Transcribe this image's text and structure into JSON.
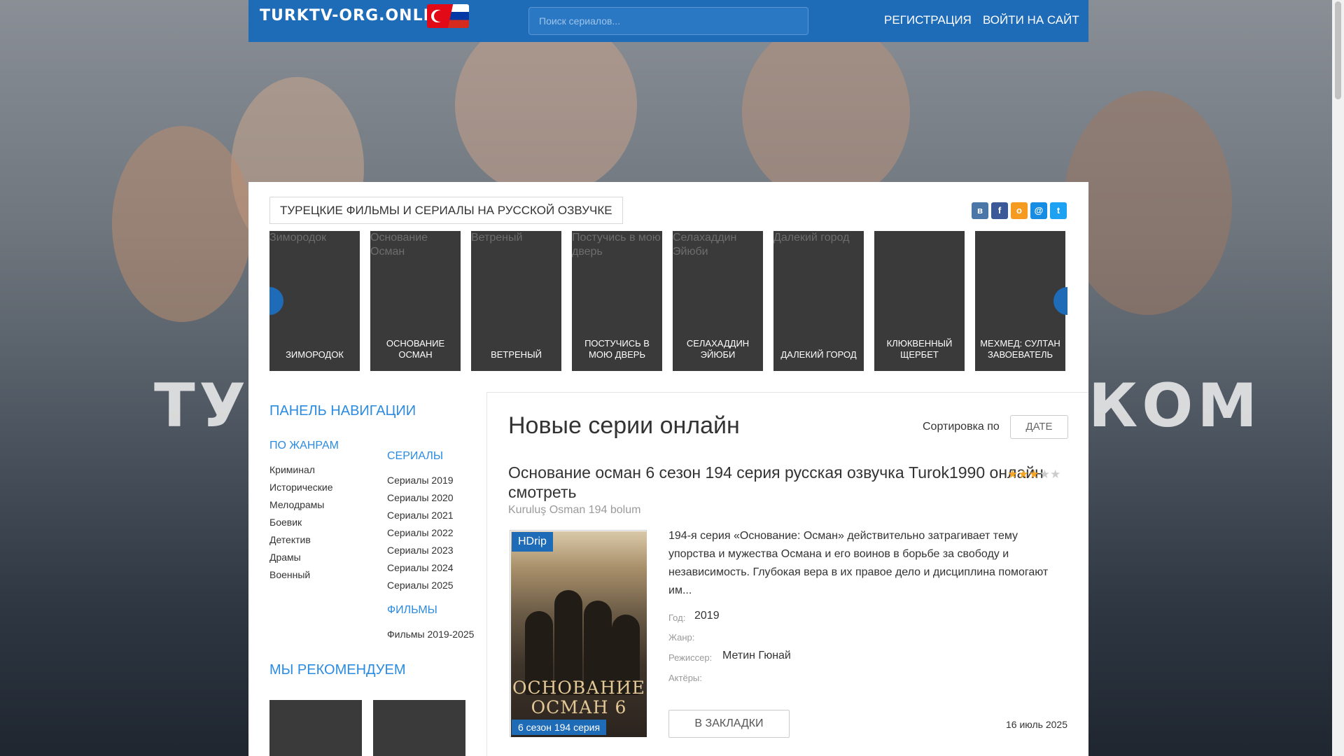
{
  "colors": {
    "brand": "#1e6bb8",
    "accent": "#2a8be0",
    "star": "#f5a623"
  },
  "header": {
    "logo_text": "TURKTV-ORG.ONLINE",
    "search_placeholder": "Поиск сериалов...",
    "register": "РЕГИСТРАЦИЯ",
    "login": "ВОЙТИ НА САЙТ"
  },
  "page_title": "ТУРЕЦКИЕ ФИЛЬМЫ И СЕРИАЛЫ НА РУССКОЙ ОЗВУЧКЕ",
  "share_icons": [
    "vk-icon",
    "facebook-icon",
    "odnoklassniki-icon",
    "moimir-icon",
    "twitter-icon"
  ],
  "slider": [
    {
      "alt": "Зимородок",
      "caption": "ЗИМОРОДОК"
    },
    {
      "alt": "Основание Осман",
      "caption": "ОСНОВАНИЕ ОСМАН"
    },
    {
      "alt": "Ветреный",
      "caption": "ВЕТРЕНЫЙ"
    },
    {
      "alt": "Постучись в мою дверь",
      "caption": "ПОСТУЧИСЬ В МОЮ ДВЕРЬ"
    },
    {
      "alt": "Селахаддин Эйюби",
      "caption": "СЕЛАХАДДИН ЭЙЮБИ"
    },
    {
      "alt": "Далекий город",
      "caption": "ДАЛЕКИЙ ГОРОД"
    },
    {
      "alt": "",
      "caption": "КЛЮКВЕННЫЙ ЩЕРБЕТ"
    },
    {
      "alt": "",
      "caption": "МЕХМЕД: СУЛТАН ЗАВОЕВАТЕЛЬ"
    }
  ],
  "sidebar": {
    "nav_title": "ПАНЕЛЬ НАВИГАЦИИ",
    "genres_title": "ПО ЖАНРАМ",
    "genres": [
      "Криминал",
      "Исторические",
      "Мелодрамы",
      "Боевик",
      "Детектив",
      "Драмы",
      "Военный"
    ],
    "series_title": "СЕРИАЛЫ",
    "series": [
      "Сериалы 2019",
      "Сериалы 2020",
      "Сериалы 2021",
      "Сериалы 2022",
      "Сериалы 2023",
      "Сериалы 2024",
      "Сериалы 2025"
    ],
    "films_title": "ФИЛЬМЫ",
    "films": [
      "Фильмы 2019-2025"
    ],
    "recommend_title": "МЫ РЕКОМЕНДУЕМ"
  },
  "content": {
    "title": "Новые серии онлайн",
    "sort_label": "Сортировка по",
    "sort_value": "ДАТЕ",
    "news": {
      "title": "Основание осман 6 сезон 194 серия русская озвучка Turok1990 онлайн смотреть",
      "rating": 3,
      "rating_max": 5,
      "original_title": "Kuruluş Osman 194 bolum",
      "quality_badge": "HDrip",
      "poster_title": "ОСНОВАНИЕ ОСМАН 6",
      "episode_badge": "6 сезон 194 серия",
      "description": "194-я серия «Основание: Осман» действительно затрагивает тему упорства и мужества Османа и его воинов в борьбе за свободу и независимость. Глубокая вера в их правое дело и дисциплина помогают им...",
      "year_label": "Год:",
      "year": "2019",
      "genre_label": "Жанр:",
      "director_label": "Режиссер:",
      "director": "Метин Гюнай",
      "actors_label": "Актёры:",
      "bookmark": "В ЗАКЛАДКИ",
      "date": "16 июль 2025"
    }
  }
}
